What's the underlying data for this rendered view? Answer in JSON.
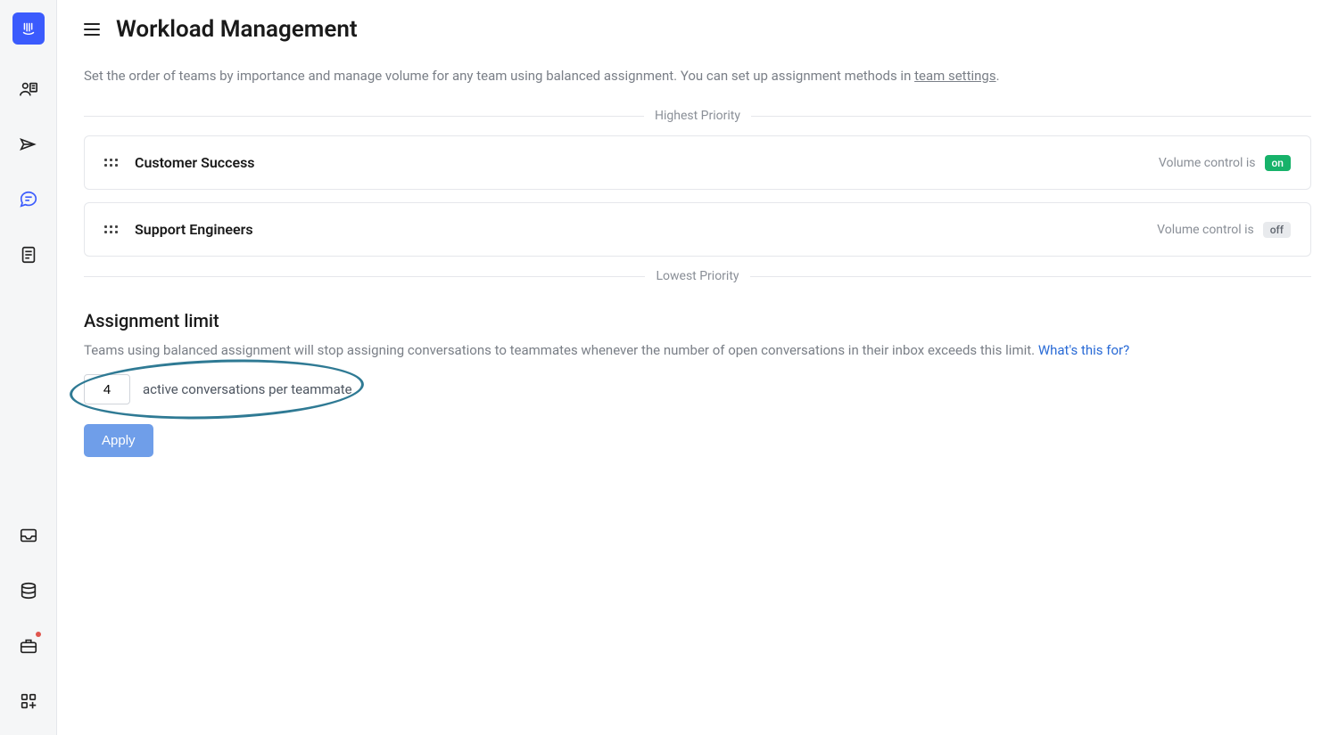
{
  "sidebar": {
    "logo_name": "intercom-logo",
    "top_items": [
      {
        "name": "contacts-icon"
      },
      {
        "name": "send-icon"
      },
      {
        "name": "chat-icon",
        "active": true
      },
      {
        "name": "document-icon"
      }
    ],
    "bottom_items": [
      {
        "name": "inbox-icon"
      },
      {
        "name": "stack-icon"
      },
      {
        "name": "briefcase-icon",
        "dot": true
      },
      {
        "name": "apps-add-icon"
      }
    ]
  },
  "header": {
    "title": "Workload Management"
  },
  "description": {
    "text_before_link": "Set the order of teams by importance and manage volume for any team using balanced assignment. You can set up assignment methods in ",
    "link_text": "team settings",
    "text_after_link": "."
  },
  "priority": {
    "highest_label": "Highest Priority",
    "lowest_label": "Lowest Priority"
  },
  "volume_control_label": "Volume control is",
  "badges": {
    "on": "on",
    "off": "off"
  },
  "teams": [
    {
      "name": "Customer Success",
      "volume_on": true
    },
    {
      "name": "Support Engineers",
      "volume_on": false
    }
  ],
  "assignment_limit": {
    "title": "Assignment limit",
    "desc_before_link": "Teams using balanced assignment will stop assigning conversations to teammates whenever the number of open conversations in their inbox exceeds this limit. ",
    "link_text": "What's this for?",
    "value": "4",
    "suffix": "active conversations per teammate",
    "apply_label": "Apply"
  }
}
